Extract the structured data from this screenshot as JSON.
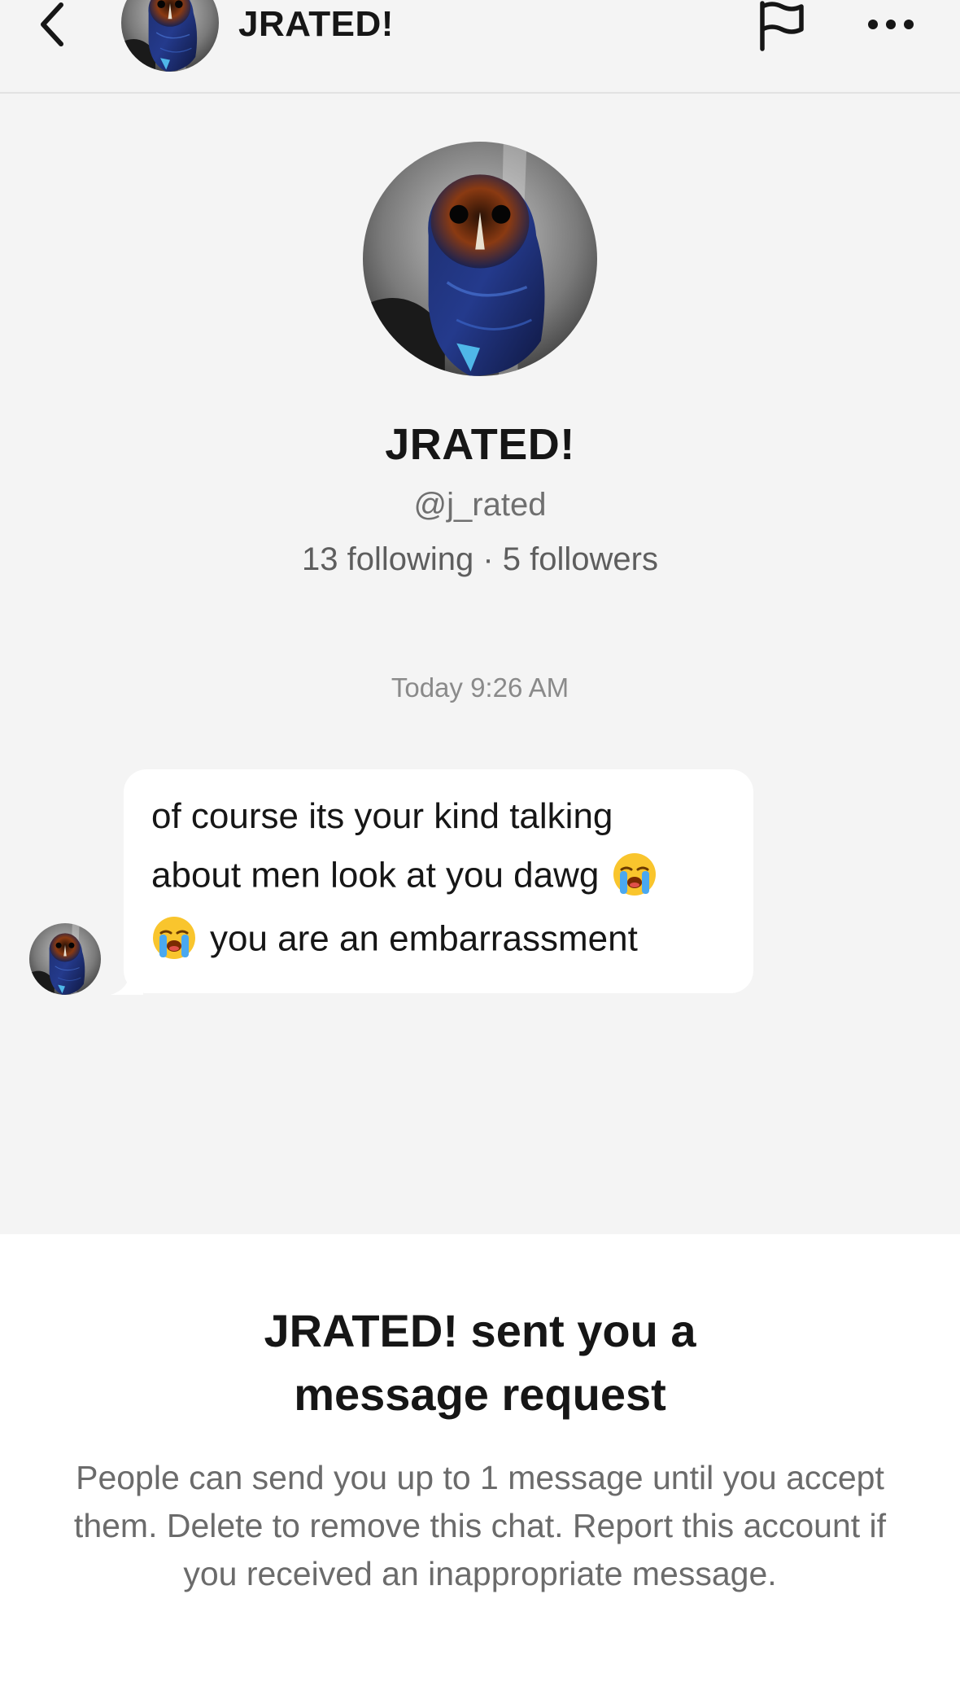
{
  "header": {
    "title": "JRATED!",
    "back_icon": "chevron-left-icon",
    "flag_icon": "flag-icon",
    "more_icon": "more-horizontal-icon"
  },
  "profile": {
    "name": "JRATED!",
    "handle": "@j_rated",
    "stats": "13 following · 5 followers"
  },
  "conversation": {
    "timestamp": "Today 9:26 AM",
    "message": {
      "line1": "of course its your kind talking",
      "line2": "about men look at you dawg",
      "line3": "you are an embarrassment",
      "emoji": "😭"
    }
  },
  "request": {
    "title": "JRATED! sent you a message request",
    "body": "People can send you up to 1 message until you accept them. Delete to remove this chat. Report this account if you received an inappropriate message."
  },
  "colors": {
    "background": "#f4f4f4",
    "bubble": "#ffffff",
    "text": "#161616",
    "muted": "#6b6b6b"
  }
}
